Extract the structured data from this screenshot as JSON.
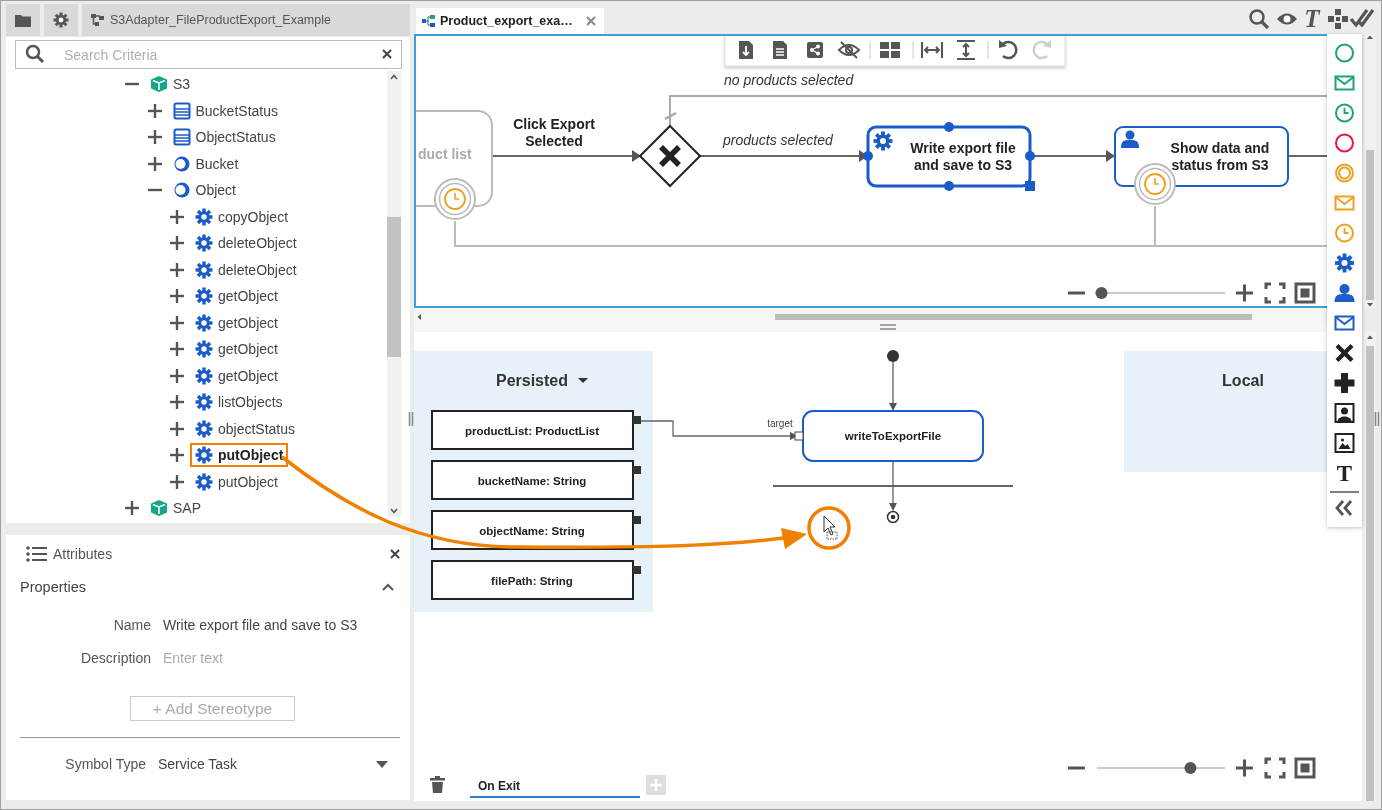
{
  "sidebar": {
    "breadcrumb": "S3Adapter_FileProductExport_Example"
  },
  "search": {
    "placeholder": "Search Criteria"
  },
  "tree": [
    {
      "label": "S3",
      "kind": "package",
      "expanded": true,
      "selected": false,
      "children": [
        {
          "label": "BucketStatus",
          "kind": "class",
          "expanded": false,
          "selected": false
        },
        {
          "label": "ObjectStatus",
          "kind": "class",
          "expanded": false,
          "selected": false
        },
        {
          "label": "Bucket",
          "kind": "object",
          "expanded": false,
          "selected": false
        },
        {
          "label": "Object",
          "kind": "object",
          "expanded": true,
          "selected": false,
          "children": [
            {
              "label": "copyObject",
              "kind": "operation",
              "expanded": false,
              "selected": false
            },
            {
              "label": "deleteObject",
              "kind": "operation",
              "expanded": false,
              "selected": false
            },
            {
              "label": "deleteObject",
              "kind": "operation",
              "expanded": false,
              "selected": false
            },
            {
              "label": "getObject",
              "kind": "operation",
              "expanded": false,
              "selected": false
            },
            {
              "label": "getObject",
              "kind": "operation",
              "expanded": false,
              "selected": false
            },
            {
              "label": "getObject",
              "kind": "operation",
              "expanded": false,
              "selected": false
            },
            {
              "label": "getObject",
              "kind": "operation",
              "expanded": false,
              "selected": false
            },
            {
              "label": "listObjects",
              "kind": "operation",
              "expanded": false,
              "selected": false
            },
            {
              "label": "objectStatus",
              "kind": "operation",
              "expanded": false,
              "selected": false
            },
            {
              "label": "putObject",
              "kind": "operation",
              "expanded": false,
              "selected": true
            },
            {
              "label": "putObject",
              "kind": "operation",
              "expanded": false,
              "selected": false
            }
          ]
        }
      ]
    },
    {
      "label": "SAP",
      "kind": "package",
      "expanded": false,
      "selected": false
    }
  ],
  "attributes": {
    "title": "Attributes",
    "section": "Properties",
    "expanded": true,
    "name_label": "Name",
    "name_value": "Write export file and save to S3",
    "description_label": "Description",
    "description_placeholder": "Enter text",
    "add_button": "+ Add Stereotype",
    "symbol_type_label": "Symbol Type",
    "symbol_type_value": "Service Task"
  },
  "editor_tab": {
    "label": "Product_export_exa…",
    "selected": true
  },
  "view_icons": [
    {
      "kind": "search"
    },
    {
      "kind": "eye"
    },
    {
      "kind": "text",
      "glyph": "T"
    },
    {
      "kind": "puzzle"
    },
    {
      "kind": "validate"
    }
  ],
  "canvas_toolbar": [
    {
      "kind": "export",
      "disabled": false
    },
    {
      "kind": "document",
      "disabled": false
    },
    {
      "kind": "share",
      "disabled": false
    },
    {
      "kind": "hide",
      "disabled": false
    },
    {
      "kind": "layout",
      "disabled": false
    },
    {
      "kind": "fit-width",
      "disabled": false
    },
    {
      "kind": "fit-height",
      "disabled": false
    },
    {
      "kind": "undo",
      "disabled": false
    },
    {
      "kind": "redo",
      "disabled": true
    }
  ],
  "process": {
    "nodes": [
      {
        "kind": "task",
        "label": "duct list",
        "boundary": {
          "kind": "timer"
        },
        "selected": false
      },
      {
        "kind": "gateway"
      },
      {
        "kind": "service-task",
        "label": "Write export file and save to S3",
        "selected": true
      },
      {
        "kind": "user-task",
        "label": "Show data and status from S3",
        "boundary": {
          "kind": "timer"
        },
        "selected": false
      }
    ],
    "flows": [
      {
        "label": "Click Export Selected"
      },
      {
        "label": "no products selected"
      },
      {
        "label": "products selected"
      }
    ],
    "zoom": {
      "level": 0.05
    }
  },
  "palette": [
    {
      "kind": "start-event",
      "color": "#1aa37a"
    },
    {
      "kind": "message-event",
      "color": "#1aa37a"
    },
    {
      "kind": "timer-event",
      "color": "#1aa37a"
    },
    {
      "kind": "end-event",
      "color": "#e8173c"
    },
    {
      "kind": "intermediate-event",
      "color": "#f0a020"
    },
    {
      "kind": "message-event",
      "color": "#f0a020"
    },
    {
      "kind": "timer-event",
      "color": "#f0a020"
    },
    {
      "kind": "service-task",
      "color": "#1a5cc8"
    },
    {
      "kind": "user-task",
      "color": "#1a5cc8"
    },
    {
      "kind": "message-event",
      "color": "#1a5cc8"
    },
    {
      "kind": "exclusive-gateway",
      "color": "#222222"
    },
    {
      "kind": "parallel-gateway",
      "color": "#222222"
    },
    {
      "kind": "contact",
      "color": "#222222"
    },
    {
      "kind": "image",
      "color": "#222222"
    },
    {
      "kind": "text",
      "color": "#222222",
      "glyph": "T"
    }
  ],
  "persisted": {
    "title": "Persisted",
    "items": [
      "productList: ProductList",
      "bucketName: String",
      "objectName: String",
      "filePath: String"
    ]
  },
  "local": {
    "title": "Local"
  },
  "activity": {
    "action": "writeToExportFile",
    "port_label": "target"
  },
  "bottom_tabs": [
    {
      "label": "On Exit",
      "selected": true
    }
  ],
  "lower_zoom": {
    "level": 0.73
  }
}
